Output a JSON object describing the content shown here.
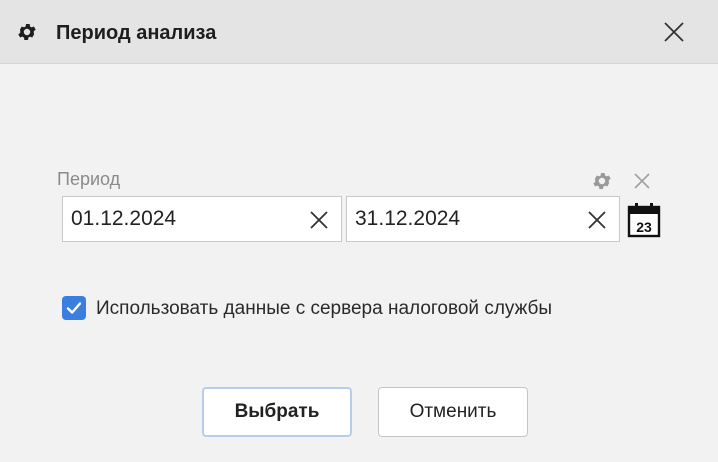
{
  "window": {
    "title": "Период анализа",
    "title_icon": "gear-icon",
    "close_icon": "close-icon"
  },
  "period": {
    "label": "Период",
    "settings_icon": "gear-icon",
    "clear_icon": "close-icon",
    "from_value": "01.12.2024",
    "to_value": "31.12.2024",
    "calendar_icon": "calendar-icon",
    "calendar_day": "23"
  },
  "option": {
    "checked": true,
    "label": "Использовать данные с сервера налоговой службы"
  },
  "buttons": {
    "select_label": "Выбрать",
    "cancel_label": "Отменить"
  },
  "colors": {
    "titlebar_bg": "#e4e4e4",
    "body_bg": "#f2f2f2",
    "checkbox_accent": "#3a7ee0",
    "default_button_border": "#b8cdea"
  }
}
